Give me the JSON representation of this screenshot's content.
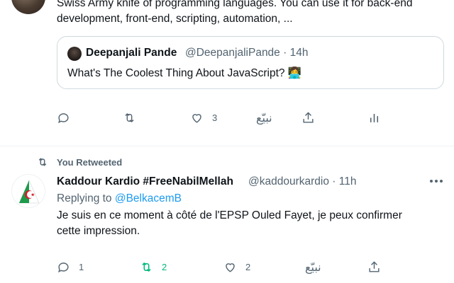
{
  "tweet1": {
    "text_line1": "Swiss Army knife of programming languages. You can use it for back-end",
    "text_line2": "development, front-end, scripting, automation, ...",
    "quote": {
      "name": "Deepanjali Pande",
      "handle_time": "@DeepanjaliPande · 14h",
      "text": "What's The Coolest Thing About JavaScript? 👩‍💻"
    },
    "actions": {
      "reply_count": "",
      "retweet_count": "",
      "like_count": "3",
      "arabic_label": "نبيّع"
    }
  },
  "retweet_header": {
    "label": "You Retweeted"
  },
  "tweet2": {
    "name": "Kaddour Kardio #FreeNabilMellah",
    "handle_time": "@kaddourkardio · 11h",
    "replying_prefix": "Replying to",
    "replying_to": "@BelkacemB",
    "text_line1": "Je suis en ce moment à côté de l'EPSP Ouled Fayet, je peux confirmer",
    "text_line2": "cette impression.",
    "actions": {
      "reply_count": "1",
      "retweet_count": "2",
      "like_count": "2",
      "arabic_label": "نبيّع"
    }
  },
  "colors": {
    "accent": "#1d9bf0",
    "retweeted": "#00ba7c",
    "muted": "#536471",
    "text": "#0f1419",
    "border": "#cfd9de"
  },
  "icons": [
    "reply-icon",
    "retweet-icon",
    "like-icon",
    "share-icon",
    "analytics-icon",
    "more-icon",
    "algeria-flag-icon"
  ]
}
